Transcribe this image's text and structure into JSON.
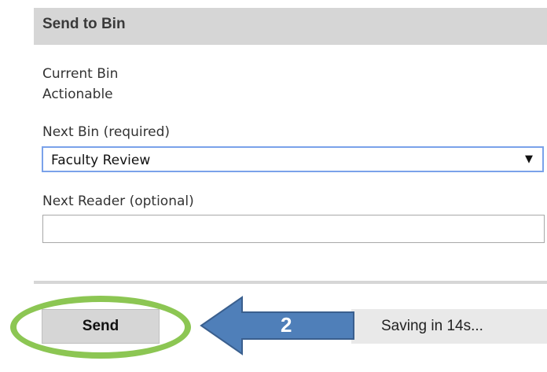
{
  "panel": {
    "title": "Send to Bin"
  },
  "current_bin": {
    "label": "Current Bin",
    "value": "Actionable"
  },
  "next_bin": {
    "label": "Next Bin (required)",
    "selected": "Faculty Review",
    "arrow_glyph": "▼"
  },
  "next_reader": {
    "label": "Next Reader (optional)",
    "value": "",
    "placeholder": ""
  },
  "actions": {
    "send_label": "Send",
    "autosave_status": "Saving in 14s..."
  },
  "annotation": {
    "step_number": "2",
    "ring_color": "#8cc653",
    "arrow_color": "#4f7fb9",
    "arrow_border_color": "#3a5f8e"
  },
  "colors": {
    "header_bg": "#d6d6d6",
    "select_border": "#7aa2ea"
  }
}
